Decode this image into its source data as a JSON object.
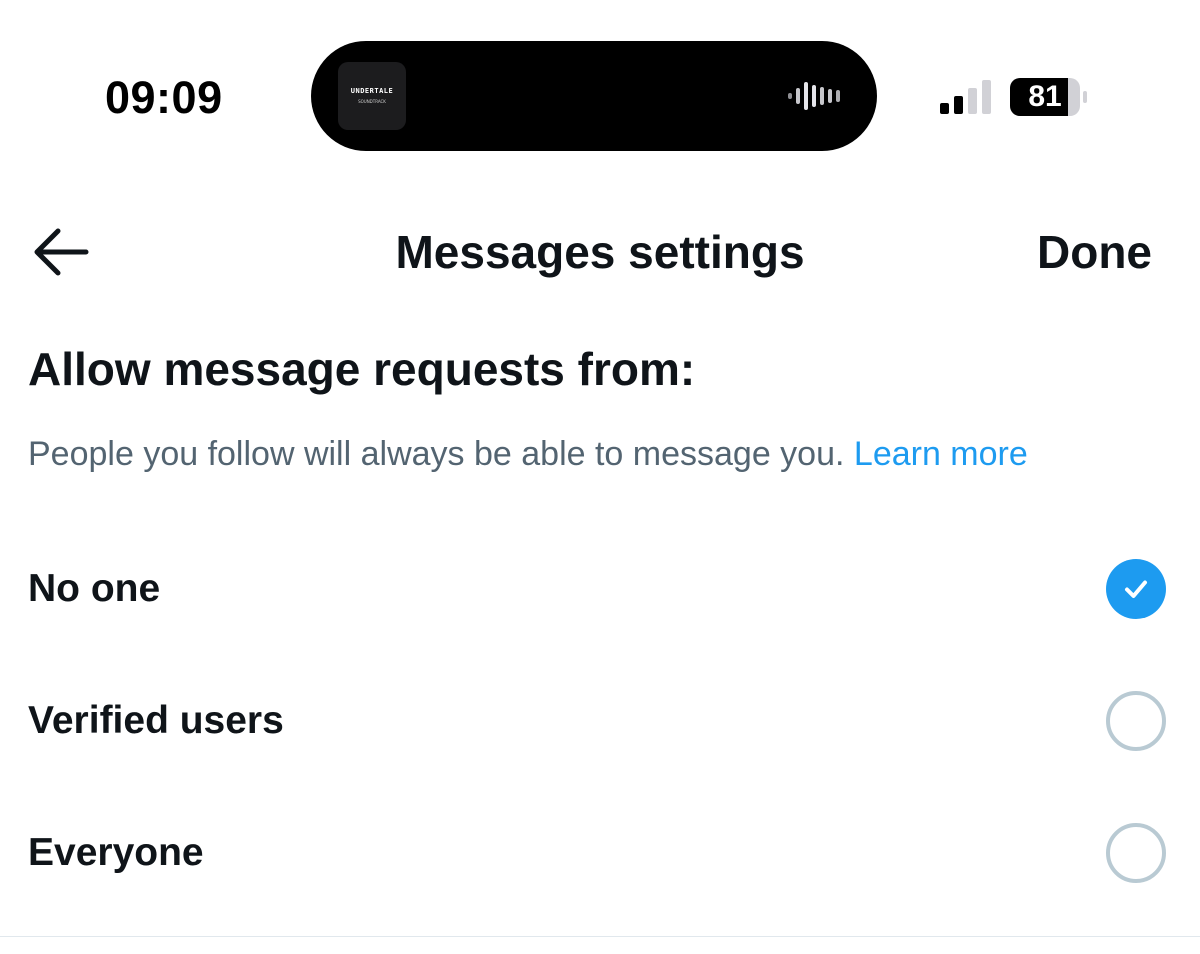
{
  "status_bar": {
    "time": "09:09",
    "battery_percent": "81",
    "signal_bars_filled": 2,
    "signal_bars_total": 4,
    "now_playing": {
      "album_title": "UNDERTALE",
      "album_subtitle": "SOUNDTRACK"
    }
  },
  "header": {
    "back_icon": "arrow-left-icon",
    "title": "Messages settings",
    "done_label": "Done"
  },
  "section": {
    "heading": "Allow message requests from:",
    "description": "People you follow will always be able to message you.",
    "learn_more_label": "Learn more"
  },
  "options": [
    {
      "label": "No one",
      "selected": true
    },
    {
      "label": "Verified users",
      "selected": false
    },
    {
      "label": "Everyone",
      "selected": false
    }
  ],
  "colors": {
    "accent": "#1d9bf0",
    "text_primary": "#0f1419",
    "text_secondary": "#536471",
    "radio_border": "#b9cad3"
  }
}
